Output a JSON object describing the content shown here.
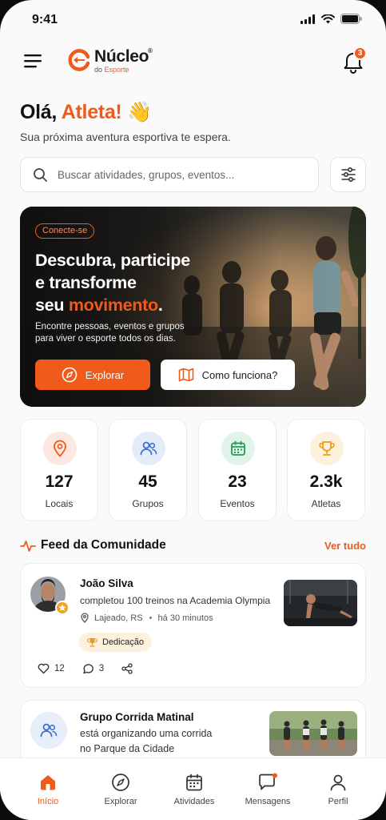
{
  "status_bar": {
    "time": "9:41"
  },
  "header": {
    "logo_name": "Núcleo",
    "logo_reg": "®",
    "logo_sub_prefix": "do",
    "logo_sub_accent": "Esporte",
    "notification_count": "3"
  },
  "greeting": {
    "hello": "Olá,",
    "name": "Atleta!",
    "emoji": "👋",
    "subtitle": "Sua próxima aventura esportiva te espera."
  },
  "search": {
    "placeholder": "Buscar atividades, grupos, eventos..."
  },
  "hero": {
    "tag": "Conecte-se",
    "title_line1": "Descubra, participe",
    "title_line2": "e transforme",
    "title_line3_prefix": "seu",
    "title_line3_accent": "movimento",
    "title_line3_suffix": ".",
    "text_line1": "Encontre pessoas, eventos e grupos",
    "text_line2": "para viver o esporte todos os dias.",
    "btn_explore": "Explorar",
    "btn_how": "Como funciona?"
  },
  "stats": [
    {
      "value": "127",
      "label": "Locais",
      "icon": "location-icon",
      "color": "#f05a1a",
      "bg": "#fde8e0"
    },
    {
      "value": "45",
      "label": "Grupos",
      "icon": "users-icon",
      "color": "#3b6fd4",
      "bg": "#e4ecfa"
    },
    {
      "value": "23",
      "label": "Eventos",
      "icon": "calendar-icon",
      "color": "#1f9d55",
      "bg": "#e2f4ea"
    },
    {
      "value": "2.3k",
      "label": "Atletas",
      "icon": "trophy-icon",
      "color": "#e8a01a",
      "bg": "#fdf1dc"
    }
  ],
  "feed": {
    "title": "Feed da Comunidade",
    "link": "Ver tudo",
    "posts": [
      {
        "name": "João Silva",
        "text": "completou 100 treinos na Academia Olympia",
        "location": "Lajeado, RS",
        "time": "há 30 minutos",
        "tag": "Dedicação",
        "likes": "12",
        "comments": "3"
      },
      {
        "name": "Grupo Corrida Matinal",
        "text_line1": "está organizando uma corrida",
        "text_line2": "no Parque da Cidade"
      }
    ]
  },
  "nav": [
    {
      "label": "Início",
      "icon": "home-icon",
      "active": true
    },
    {
      "label": "Explorar",
      "icon": "compass-icon"
    },
    {
      "label": "Atividades",
      "icon": "calendar-icon"
    },
    {
      "label": "Mensagens",
      "icon": "chat-icon"
    },
    {
      "label": "Perfil",
      "icon": "user-icon"
    }
  ],
  "colors": {
    "accent": "#f05a1a",
    "text": "#111111",
    "muted": "#444444",
    "background": "#fafafa"
  }
}
